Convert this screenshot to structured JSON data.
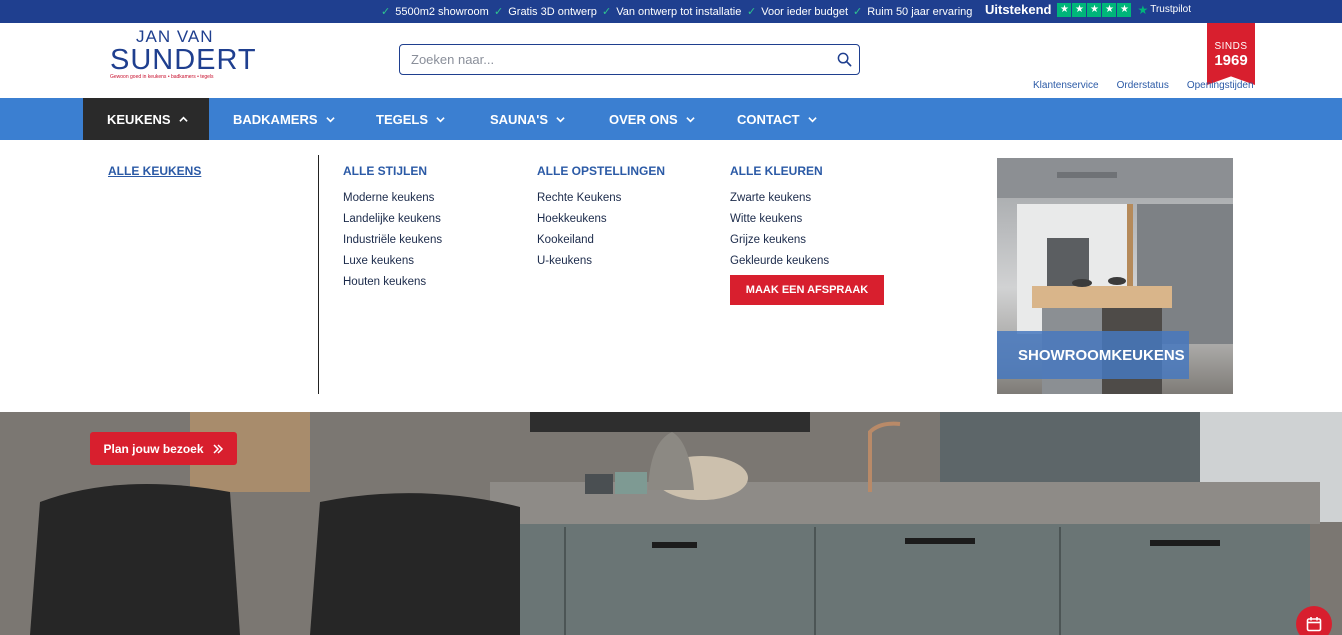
{
  "topbar": {
    "usps": [
      "5500m2 showroom",
      "Gratis 3D ontwerp",
      "Van ontwerp tot installatie",
      "Voor ieder budget",
      "Ruim 50 jaar ervaring"
    ],
    "rating_label": "Uitstekend",
    "rating_stars": 5,
    "trustpilot_label": "Trustpilot"
  },
  "header": {
    "logo": {
      "line1": "JAN VAN",
      "line2": "SUNDERT",
      "tagline": "Gewoon goed in keukens • badkamers • tegels"
    },
    "search_placeholder": "Zoeken naar...",
    "badge": {
      "top": "SINDS",
      "year": "1969"
    },
    "utility_links": [
      "Klantenservice",
      "Orderstatus",
      "Openingstijden"
    ]
  },
  "nav": {
    "items": [
      "KEUKENS",
      "BADKAMERS",
      "TEGELS",
      "SAUNA'S",
      "OVER ONS",
      "CONTACT"
    ],
    "active": "KEUKENS"
  },
  "mega_menu": {
    "all_link": "ALLE KEUKENS",
    "columns": [
      {
        "heading": "ALLE STIJLEN",
        "links": [
          "Moderne keukens",
          "Landelijke keukens",
          "Industriële keukens",
          "Luxe keukens",
          "Houten keukens"
        ]
      },
      {
        "heading": "ALLE OPSTELLINGEN",
        "links": [
          "Rechte Keukens",
          "Hoekkeukens",
          "Kookeiland",
          "U-keukens"
        ]
      },
      {
        "heading": "ALLE KLEUREN",
        "links": [
          "Zwarte keukens",
          "Witte keukens",
          "Grijze keukens",
          "Gekleurde keukens"
        ]
      }
    ],
    "cta_label": "MAAK EEN AFSPRAAK",
    "promo_label": "SHOWROOMKEUKENS"
  },
  "hero": {
    "plan_button": "Plan jouw bezoek"
  },
  "colors": {
    "topbar": "#1f3f8f",
    "nav": "#3b7fd1",
    "nav_active": "#2a2a2a",
    "accent_red": "#d81f2e",
    "link_blue": "#2b5aa6",
    "trustpilot_green": "#00b67a"
  },
  "icons": [
    "check-icon",
    "search-icon",
    "chevron-down-icon",
    "chevron-up-icon",
    "double-chevron-right-icon",
    "calendar-icon",
    "trustpilot-star-icon"
  ]
}
